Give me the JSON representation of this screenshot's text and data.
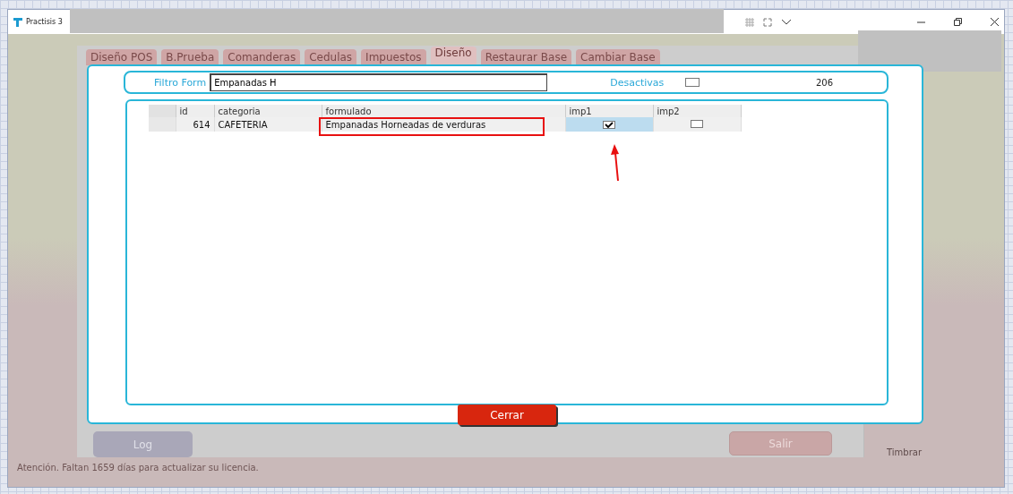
{
  "window": {
    "title": "Practisis 3"
  },
  "background_app": {
    "tabs": [
      {
        "label": "Diseño POS",
        "selected": false
      },
      {
        "label": "B.Prueba",
        "selected": false
      },
      {
        "label": "Comanderas",
        "selected": false
      },
      {
        "label": "Cedulas",
        "selected": false
      },
      {
        "label": "Impuestos",
        "selected": false
      },
      {
        "label": "Diseño",
        "selected": true
      },
      {
        "label": "Restaurar Base",
        "selected": false
      },
      {
        "label": "Cambiar Base",
        "selected": false
      }
    ],
    "log_button": "Log",
    "exit_button": "Salir",
    "side_label": "Timbrar",
    "license_notice": "Atención. Faltan 1659 días para actualizar su licencia."
  },
  "dialog": {
    "filter": {
      "label": "Filtro Form",
      "value": "Empanadas H"
    },
    "inactive": {
      "label": "Desactivas",
      "checked": false
    },
    "count": "206",
    "table": {
      "columns": [
        "id",
        "categoria",
        "formulado",
        "imp1",
        "imp2"
      ],
      "rows": [
        {
          "cells": [
            {
              "kind": "text",
              "text": "614",
              "focused": false
            },
            {
              "kind": "text",
              "text": "CAFETERIA",
              "focused": false
            },
            {
              "kind": "text",
              "text": "Empanadas Horneadas de verduras",
              "focused": false
            },
            {
              "kind": "checkbox",
              "checked": true,
              "focused": true
            },
            {
              "kind": "checkbox",
              "checked": false,
              "focused": false
            }
          ]
        }
      ]
    },
    "close_button": "Cerrar"
  },
  "annotations": [
    {
      "kind": "box"
    },
    {
      "kind": "arrow"
    }
  ]
}
